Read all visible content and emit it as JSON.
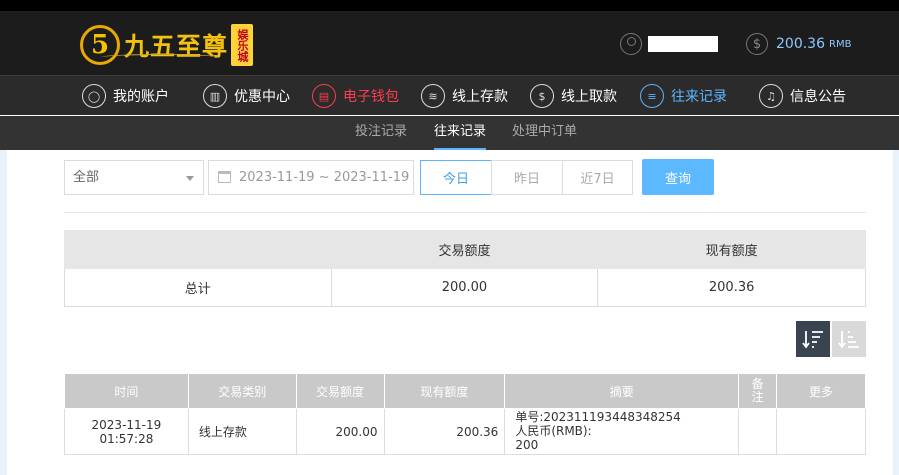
{
  "brand": {
    "logo_glyph": "5",
    "name": "九五至尊",
    "badge": "娱乐城"
  },
  "account": {
    "balance": "200.36",
    "currency": "RMB"
  },
  "main_nav": [
    {
      "label": "我的账户",
      "icon": "user-icon"
    },
    {
      "label": "优惠中心",
      "icon": "gift-icon"
    },
    {
      "label": "电子钱包",
      "icon": "wallet-icon"
    },
    {
      "label": "线上存款",
      "icon": "deposit-icon"
    },
    {
      "label": "线上取款",
      "icon": "withdraw-icon"
    },
    {
      "label": "往来记录",
      "icon": "records-icon"
    },
    {
      "label": "信息公告",
      "icon": "bell-icon"
    }
  ],
  "sub_nav": [
    {
      "label": "投注记录"
    },
    {
      "label": "往来记录"
    },
    {
      "label": "处理中订单"
    }
  ],
  "filters": {
    "type_select": "全部",
    "date_range": "2023-11-19 ~ 2023-11-19",
    "quick": [
      "今日",
      "昨日",
      "近7日"
    ],
    "search_label": "查询"
  },
  "summary": {
    "headers": [
      "",
      "交易额度",
      "现有额度"
    ],
    "row": [
      "总计",
      "200.00",
      "200.36"
    ]
  },
  "detail": {
    "headers": [
      "时间",
      "交易类别",
      "交易额度",
      "现有额度",
      "摘要",
      "备注",
      "更多"
    ],
    "rows": [
      {
        "time": "2023-11-19 01:57:28",
        "category": "线上存款",
        "amount": "200.00",
        "balance": "200.36",
        "summary_line1": "单号:202311193448348254",
        "summary_line2": "人民币(RMB):",
        "summary_line3": "200",
        "remark": "",
        "more": ""
      }
    ]
  },
  "colors": {
    "accent_blue": "#5cb4ff",
    "accent_red": "#ff3b4f",
    "brand_gold": "#f3c20d"
  }
}
